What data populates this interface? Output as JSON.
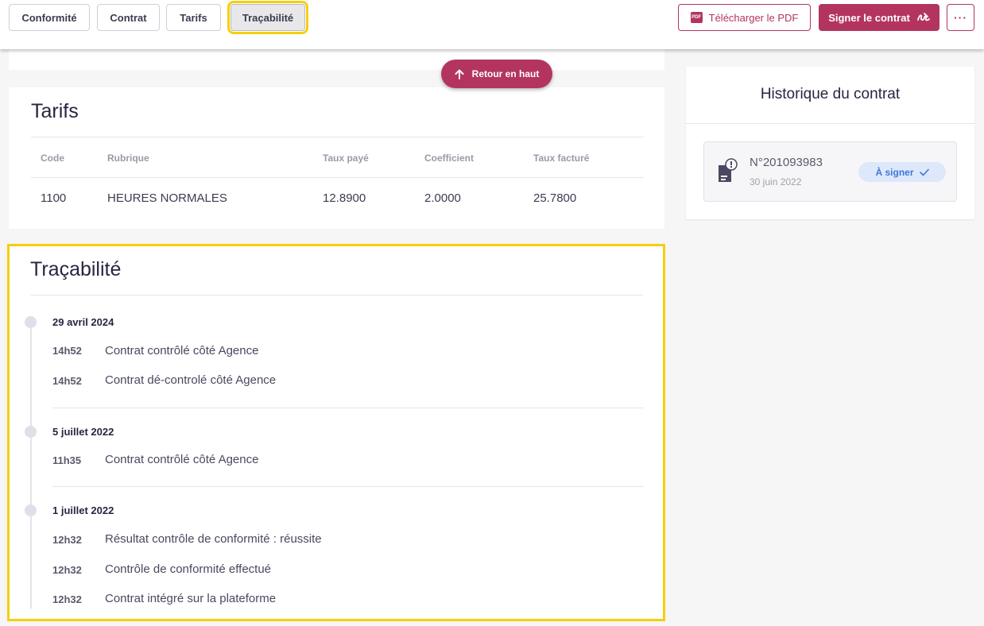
{
  "tabs": [
    {
      "label": "Conformité"
    },
    {
      "label": "Contrat"
    },
    {
      "label": "Tarifs"
    },
    {
      "label": "Traçabilité",
      "active": true
    }
  ],
  "actions": {
    "pdf_label": "Télécharger le PDF",
    "pdf_icon_text": "PDF",
    "sign_label": "Signer le contrat",
    "more_label": "···"
  },
  "back_to_top": {
    "label": "Retour en haut"
  },
  "tarifs": {
    "title": "Tarifs",
    "columns": [
      "Code",
      "Rubrique",
      "Taux payé",
      "Coefficient",
      "Taux facturé"
    ],
    "rows": [
      [
        "1100",
        "HEURES NORMALES",
        "12.8900",
        "2.0000",
        "25.7800"
      ]
    ]
  },
  "tracabilite": {
    "title": "Traçabilité",
    "groups": [
      {
        "date": "29 avril 2024",
        "events": [
          {
            "time": "14h52",
            "text": "Contrat contrôlé côté Agence"
          },
          {
            "time": "14h52",
            "text": "Contrat dé-controlé côté Agence"
          }
        ]
      },
      {
        "date": "5 juillet 2022",
        "events": [
          {
            "time": "11h35",
            "text": "Contrat contrôlé côté Agence"
          }
        ]
      },
      {
        "date": "1 juillet 2022",
        "events": [
          {
            "time": "12h32",
            "text": "Résultat contrôle de conformité : réussite"
          },
          {
            "time": "12h32",
            "text": "Contrôle de conformité effectué"
          },
          {
            "time": "12h32",
            "text": "Contrat intégré sur la plateforme"
          }
        ]
      }
    ]
  },
  "history": {
    "title": "Historique du contrat",
    "item": {
      "number": "N°201093983",
      "date": "30 juin 2022",
      "status": "À signer"
    }
  },
  "colors": {
    "brand": "#b3355f",
    "highlight": "#f6cf0b",
    "badge_bg": "#dde8fb",
    "badge_text": "#3f78d9"
  }
}
